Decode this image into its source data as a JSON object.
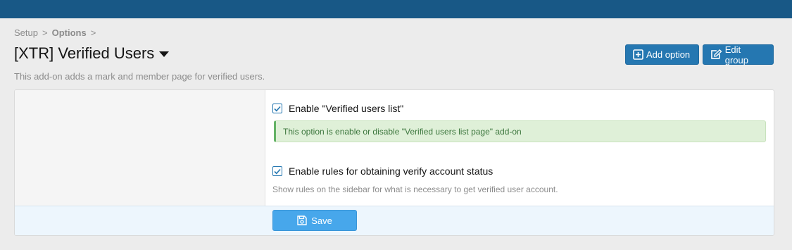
{
  "breadcrumb": {
    "items": [
      "Setup",
      "Options"
    ],
    "separator": ">"
  },
  "page": {
    "title": "[XTR] Verified Users",
    "description": "This add-on adds a mark and member page for verified users."
  },
  "actions": {
    "add_option": "Add option",
    "edit_group": "Edit group"
  },
  "options": [
    {
      "label": "Enable \"Verified users list\"",
      "checked": true,
      "explain": "This option is enable or disable \"Verified users list page\" add-on"
    },
    {
      "label": "Enable rules for obtaining verify account status",
      "checked": true,
      "hint": "Show rules on the sidebar for what is necessary to get verified user account."
    }
  ],
  "footer": {
    "save_label": "Save"
  },
  "colors": {
    "topbar": "#185886",
    "primary_button": "#2577b1",
    "save_button": "#47a7eb",
    "success_bg": "#dff0d8"
  },
  "icons": {
    "add_option": "plus-square-icon",
    "edit_group": "edit-icon",
    "save": "floppy-disk-icon",
    "title_menu": "caret-down-icon",
    "checkbox": "checkmark-icon"
  }
}
